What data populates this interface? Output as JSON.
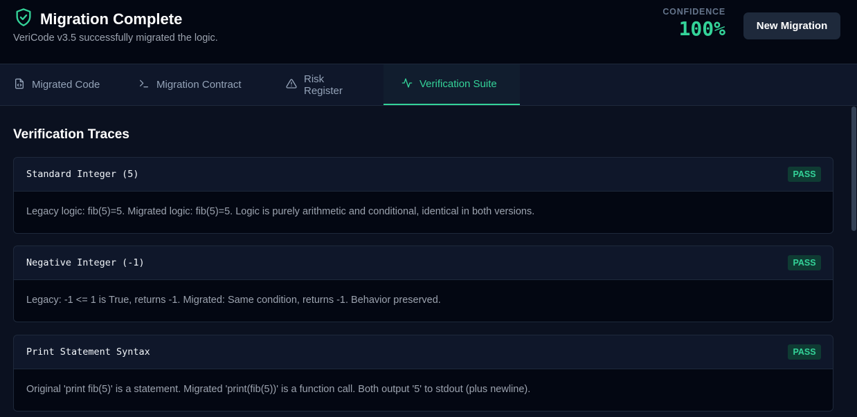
{
  "header": {
    "title": "Migration Complete",
    "subtitle": "VeriCode v3.5 successfully migrated the logic.",
    "confidence_label": "CONFIDENCE",
    "confidence_value": "100%",
    "new_migration_label": "New Migration"
  },
  "tabs": [
    {
      "label": "Migrated Code",
      "icon": "file-code-icon",
      "active": false
    },
    {
      "label": "Migration Contract",
      "icon": "terminal-icon",
      "active": false
    },
    {
      "label": "Risk Register",
      "icon": "warning-icon",
      "active": false
    },
    {
      "label": "Verification Suite",
      "icon": "activity-icon",
      "active": true
    }
  ],
  "section": {
    "title": "Verification Traces"
  },
  "traces": [
    {
      "name": "Standard Integer (5)",
      "status": "PASS",
      "description": "Legacy logic: fib(5)=5. Migrated logic: fib(5)=5. Logic is purely arithmetic and conditional, identical in both versions."
    },
    {
      "name": "Negative Integer (-1)",
      "status": "PASS",
      "description": "Legacy: -1 <= 1 is True, returns -1. Migrated: Same condition, returns -1. Behavior preserved."
    },
    {
      "name": "Print Statement Syntax",
      "status": "PASS",
      "description": "Original 'print fib(5)' is a statement. Migrated 'print(fib(5))' is a function call. Both output '5' to stdout (plus newline)."
    }
  ],
  "colors": {
    "accent": "#34d399",
    "background": "#0b1120",
    "header_bg": "#030712"
  }
}
